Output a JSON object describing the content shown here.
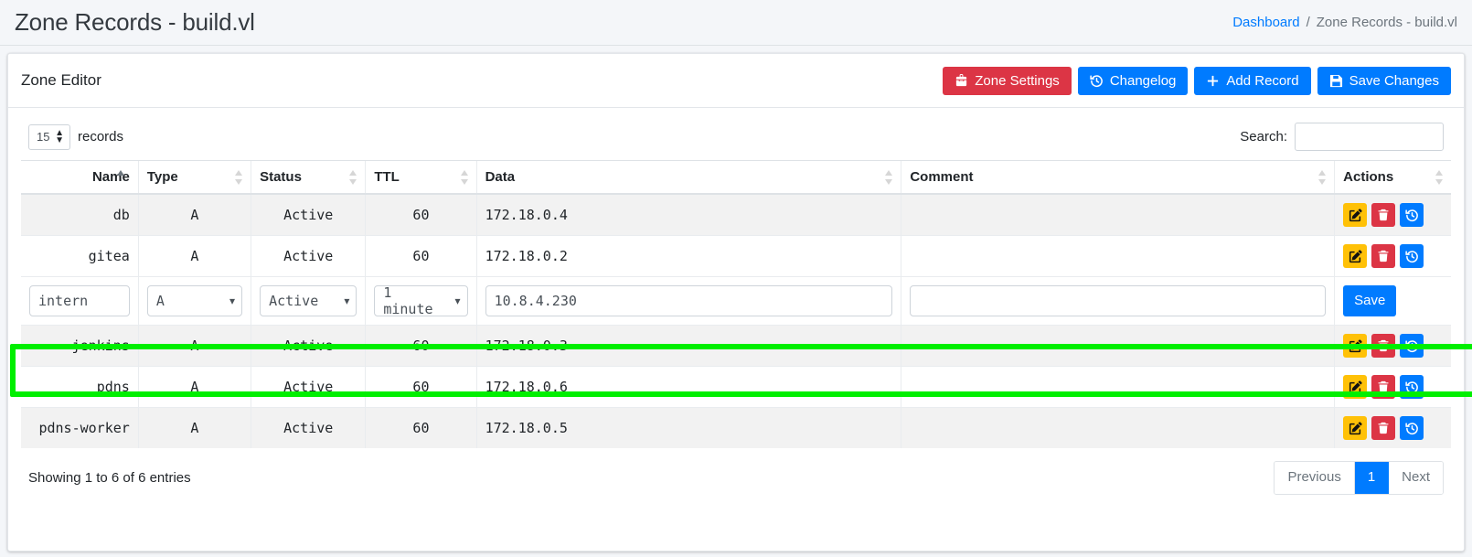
{
  "header": {
    "title": "Zone Records - build.vl",
    "breadcrumb": {
      "link": "Dashboard",
      "separator": "/",
      "current": "Zone Records - build.vl"
    }
  },
  "card": {
    "title": "Zone Editor",
    "buttons": [
      {
        "label": "Zone Settings",
        "icon": "toolbox-icon",
        "color": "#dc3545"
      },
      {
        "label": "Changelog",
        "icon": "history-icon",
        "color": "#007bff"
      },
      {
        "label": "Add Record",
        "icon": "plus-icon",
        "color": "#007bff"
      },
      {
        "label": "Save Changes",
        "icon": "floppy-save-icon",
        "color": "#007bff"
      }
    ]
  },
  "controls": {
    "page_length": "15",
    "records_label": "records",
    "search_label": "Search:",
    "search_value": "",
    "search_placeholder": ""
  },
  "table": {
    "columns": [
      {
        "label": "Name",
        "sort": "asc"
      },
      {
        "label": "Type",
        "sort": "none"
      },
      {
        "label": "Status",
        "sort": "none"
      },
      {
        "label": "TTL",
        "sort": "none"
      },
      {
        "label": "Data",
        "sort": "none"
      },
      {
        "label": "Comment",
        "sort": "none"
      },
      {
        "label": "Actions",
        "sort": "none"
      }
    ],
    "rows": [
      {
        "name": "db",
        "type": "A",
        "status": "Active",
        "ttl": "60",
        "data": "172.18.0.4",
        "comment": ""
      },
      {
        "name": "gitea",
        "type": "A",
        "status": "Active",
        "ttl": "60",
        "data": "172.18.0.2",
        "comment": ""
      },
      {
        "name": "jenkins",
        "type": "A",
        "status": "Active",
        "ttl": "60",
        "data": "172.18.0.3",
        "comment": ""
      },
      {
        "name": "pdns",
        "type": "A",
        "status": "Active",
        "ttl": "60",
        "data": "172.18.0.6",
        "comment": ""
      },
      {
        "name": "pdns-worker",
        "type": "A",
        "status": "Active",
        "ttl": "60",
        "data": "172.18.0.5",
        "comment": ""
      }
    ],
    "edit_row": {
      "name": "intern",
      "type": "A",
      "status": "Active",
      "ttl": "1 minute",
      "data": "10.8.4.230",
      "comment": "",
      "save_label": "Save",
      "highlight_color": "#00ef00"
    },
    "row_actions": [
      {
        "name": "edit-record-button",
        "icon": "pencil-square-icon",
        "color": "#ffc107"
      },
      {
        "name": "delete-record-button",
        "icon": "trash-icon",
        "color": "#dc3545"
      },
      {
        "name": "record-history-button",
        "icon": "history-icon",
        "color": "#007bff"
      }
    ]
  },
  "footer": {
    "info": "Showing 1 to 6 of 6 entries",
    "pagination": {
      "previous": "Previous",
      "pages": [
        "1"
      ],
      "next": "Next",
      "active": "1"
    }
  }
}
